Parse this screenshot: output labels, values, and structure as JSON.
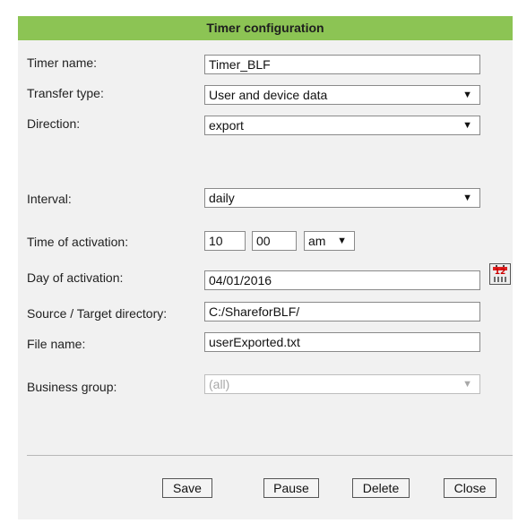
{
  "dialog": {
    "title": "Timer configuration"
  },
  "form": {
    "timer_name": {
      "label": "Timer name:",
      "value": "Timer_BLF"
    },
    "transfer_type": {
      "label": "Transfer type:",
      "value": "User and device data"
    },
    "direction": {
      "label": "Direction:",
      "value": "export"
    },
    "interval": {
      "label": "Interval:",
      "value": "daily"
    },
    "time_of_activation": {
      "label": "Time of activation:",
      "hour": "10",
      "minute": "00",
      "ampm": "am"
    },
    "day_of_activation": {
      "label": "Day of activation:",
      "value": "04/01/2016",
      "calendar_icon_digits": "12"
    },
    "source_target_directory": {
      "label": "Source / Target directory:",
      "value": "C:/ShareforBLF/"
    },
    "file_name": {
      "label": "File name:",
      "value": "userExported.txt"
    },
    "business_group": {
      "label": "Business group:",
      "value": "(all)",
      "disabled": true
    }
  },
  "buttons": {
    "save": "Save",
    "pause": "Pause",
    "delete": "Delete",
    "close": "Close"
  },
  "colors": {
    "title_bar": "#8cc454",
    "panel_background": "#f1f1f1"
  },
  "icons": {
    "dropdown_arrow": "▼",
    "calendar": "calendar-icon"
  }
}
